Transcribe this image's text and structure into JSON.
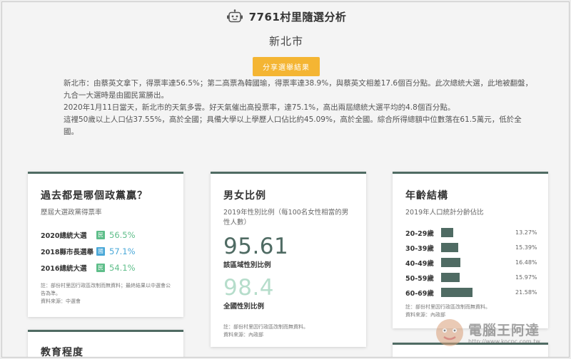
{
  "header": {
    "app_title": "7761村里隨選分析",
    "city": "新北市",
    "share_button": "分享選舉結果"
  },
  "summary": {
    "lines": [
      "新北市：由蔡英文拿下，得票率達56.5%；第二高票為韓國瑜，得票率達38.9%，與蔡英文相差17.6個百分點。此次總統大選，此地被翻盤，九合一大選時是由國民黨勝出。",
      "2020年1月11日當天，新北市的天氣多雲。好天氣催出高投票率，達75.1%，高出兩屆總統大選平均的4.8個百分點。",
      "這裡50歲以上人口佔37.55%，高於全國；具備大學以上學歷人口佔比約45.09%，高於全國。綜合所得總額中位數落在61.5萬元，低於全國。"
    ]
  },
  "party_card": {
    "title": "過去都是哪個政黨贏？",
    "subtitle": "歷屆大選政黨得票率",
    "rows": [
      {
        "label": "2020總統大選",
        "badge": "民",
        "badge_color": "#5fbe8a",
        "value": "56.5%",
        "value_color": "#5fbe8a"
      },
      {
        "label": "2018縣市長選舉",
        "badge": "國",
        "badge_color": "#4aa8d8",
        "value": "57.1%",
        "value_color": "#4aa8d8"
      },
      {
        "label": "2016總統大選",
        "badge": "民",
        "badge_color": "#5fbe8a",
        "value": "54.1%",
        "value_color": "#5fbe8a"
      }
    ],
    "note": "註：部份村里因行政區改制而無資料；最終結果以中選會公告為準。",
    "source": "資料來源：中選會"
  },
  "gender_card": {
    "title": "男女比例",
    "subtitle": "2019年性別比例（每100名女性相當的男性人數）",
    "local_value": "95.61",
    "local_label": "該區域性別比例",
    "national_value": "98.4",
    "national_label": "全國性別比例",
    "note": "註：部份村里因行政區改制而無資料。",
    "source": "資料來源：內政部"
  },
  "age_card": {
    "title": "年齡結構",
    "subtitle": "2019年人口統計分齡佔比",
    "rows": [
      {
        "label": "20-29歲",
        "value": 13.27,
        "display": "13.27%"
      },
      {
        "label": "30-39歲",
        "value": 15.39,
        "display": "15.39%"
      },
      {
        "label": "40-49歲",
        "value": 16.48,
        "display": "16.48%"
      },
      {
        "label": "50-59歲",
        "value": 15.97,
        "display": "15.97%"
      },
      {
        "label": "60-69歲",
        "value": 21.58,
        "display": "21.58%"
      }
    ],
    "note": "註：部份村里因行政區改制而無資料。",
    "source": "資料來源：內政部"
  },
  "edu_card": {
    "title": "教育程度"
  },
  "watermark": {
    "text": "電腦王阿達",
    "url": "http://www.kocpc.com.tw"
  },
  "colors": {
    "accent": "#4f6b63",
    "share_button": "#f4b533",
    "local_value": "#4f6b63",
    "national_value": "#b6ddcb"
  }
}
